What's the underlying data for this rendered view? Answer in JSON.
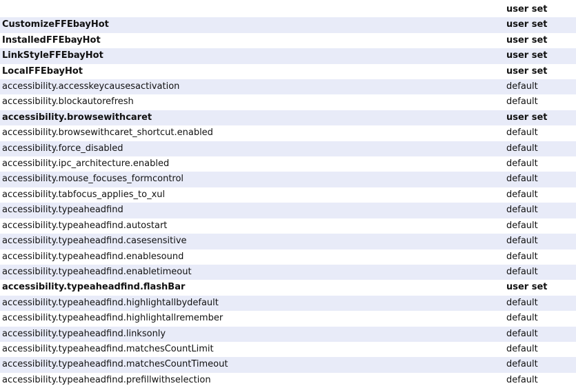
{
  "preferences": [
    {
      "name": "",
      "status": "user set",
      "bold": true
    },
    {
      "name": "CustomizeFFEbayHot",
      "status": "user set",
      "bold": true
    },
    {
      "name": "InstalledFFEbayHot",
      "status": "user set",
      "bold": true
    },
    {
      "name": "LinkStyleFFEbayHot",
      "status": "user set",
      "bold": true
    },
    {
      "name": "LocalFFEbayHot",
      "status": "user set",
      "bold": true
    },
    {
      "name": "accessibility.accesskeycausesactivation",
      "status": "default",
      "bold": false
    },
    {
      "name": "accessibility.blockautorefresh",
      "status": "default",
      "bold": false
    },
    {
      "name": "accessibility.browsewithcaret",
      "status": "user set",
      "bold": true
    },
    {
      "name": "accessibility.browsewithcaret_shortcut.enabled",
      "status": "default",
      "bold": false
    },
    {
      "name": "accessibility.force_disabled",
      "status": "default",
      "bold": false
    },
    {
      "name": "accessibility.ipc_architecture.enabled",
      "status": "default",
      "bold": false
    },
    {
      "name": "accessibility.mouse_focuses_formcontrol",
      "status": "default",
      "bold": false
    },
    {
      "name": "accessibility.tabfocus_applies_to_xul",
      "status": "default",
      "bold": false
    },
    {
      "name": "accessibility.typeaheadfind",
      "status": "default",
      "bold": false
    },
    {
      "name": "accessibility.typeaheadfind.autostart",
      "status": "default",
      "bold": false
    },
    {
      "name": "accessibility.typeaheadfind.casesensitive",
      "status": "default",
      "bold": false
    },
    {
      "name": "accessibility.typeaheadfind.enablesound",
      "status": "default",
      "bold": false
    },
    {
      "name": "accessibility.typeaheadfind.enabletimeout",
      "status": "default",
      "bold": false
    },
    {
      "name": "accessibility.typeaheadfind.flashBar",
      "status": "user set",
      "bold": true
    },
    {
      "name": "accessibility.typeaheadfind.highlightallbydefault",
      "status": "default",
      "bold": false
    },
    {
      "name": "accessibility.typeaheadfind.highlightallremember",
      "status": "default",
      "bold": false
    },
    {
      "name": "accessibility.typeaheadfind.linksonly",
      "status": "default",
      "bold": false
    },
    {
      "name": "accessibility.typeaheadfind.matchesCountLimit",
      "status": "default",
      "bold": false
    },
    {
      "name": "accessibility.typeaheadfind.matchesCountTimeout",
      "status": "default",
      "bold": false
    },
    {
      "name": "accessibility.typeaheadfind.prefillwithselection",
      "status": "default",
      "bold": false
    }
  ]
}
